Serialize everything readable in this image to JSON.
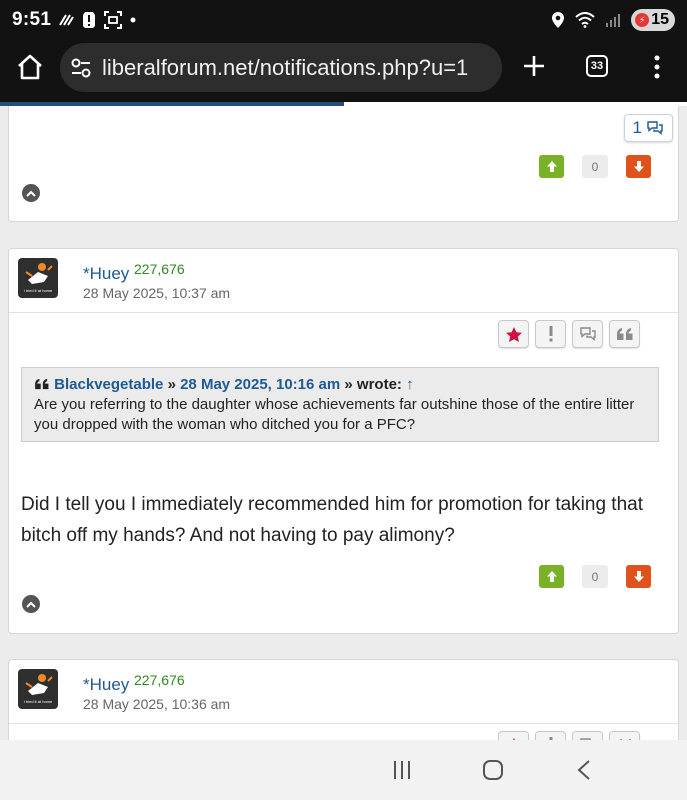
{
  "status_bar": {
    "time": "9:51",
    "left_icons": [
      "wavy-lines-icon",
      "alert-icon",
      "screenshot-icon",
      "dot-icon"
    ],
    "right_icons": [
      "location-icon",
      "wifi-icon",
      "signal-icon"
    ],
    "battery_level": "15"
  },
  "browser": {
    "url": "liberalforum.net/notifications.php?u=1",
    "tab_count": "33",
    "load_progress": 0.5
  },
  "posts": [
    {
      "replies_count": "1",
      "vote_count": "0"
    },
    {
      "username": "*Huey",
      "post_count": "227,676",
      "date": "28 May 2025, 10:37 am",
      "avatar_caption": "i tried it at home",
      "quote": {
        "author": "Blackvegetable",
        "separator": "»",
        "date": "28 May 2025, 10:16 am",
        "wrote": "» wrote:",
        "arrow": "↑",
        "text": "Are you referring to the daughter whose achievements far outshine those of the entire litter you dropped with the woman who ditched you for a PFC?"
      },
      "text": "Did I tell you I immediately recommended him for promotion for taking that bitch off my hands?  And not having to pay alimony?",
      "vote_count": "0"
    },
    {
      "username": "*Huey",
      "post_count": "227,676",
      "date": "28 May 2025, 10:36 am",
      "avatar_caption": "i tried it at home"
    }
  ],
  "colors": {
    "link": "#1f5a93",
    "post_count": "#2e8b1e",
    "vote_up": "#79b226",
    "vote_down": "#e0521c",
    "favorite": "#d0123e"
  }
}
